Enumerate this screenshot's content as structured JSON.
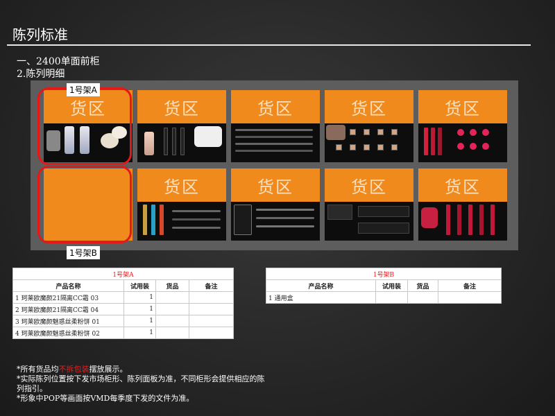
{
  "page": {
    "title": "陈列标准",
    "heading_1": "一、2400单面前柜",
    "heading_2": "2.陈列明细"
  },
  "tiles": {
    "band_label": "货区"
  },
  "racks": {
    "a_label": "1号架A",
    "b_label": "1号架B"
  },
  "table_a": {
    "caption": "1号架A",
    "headers": [
      "产品名称",
      "试用装",
      "货品",
      "备注"
    ],
    "rows": [
      {
        "name": "1 珂莱欧魔颜21隔离CC霜 03",
        "tester": "1",
        "goods": "",
        "note": ""
      },
      {
        "name": "2 珂莱欧魔颜21隔离CC霜 04",
        "tester": "1",
        "goods": "",
        "note": ""
      },
      {
        "name": "3 珂莱欧魔颜魅惑丝柔粉饼 01",
        "tester": "1",
        "goods": "",
        "note": ""
      },
      {
        "name": "4 珂莱欧魔颜魅惑丝柔粉饼 02",
        "tester": "1",
        "goods": "",
        "note": ""
      }
    ]
  },
  "table_b": {
    "caption": "1号架B",
    "headers": [
      "产品名称",
      "试用装",
      "货品",
      "备注"
    ],
    "rows": [
      {
        "name": "1 通用盒",
        "tester": "",
        "goods": "",
        "note": ""
      }
    ]
  },
  "notes": {
    "line1_prefix": "*所有货品均",
    "line1_highlight": "不拆包装",
    "line1_suffix": "摆放展示。",
    "line2": "*实际陈列位置按下发市场柜形、陈列面板为准，不同柜形会提供相应的陈列指引。",
    "line3": "*形象中POP等画面按VMD每季度下发的文件为准。"
  },
  "colors": {
    "accent_orange": "#f08a1c",
    "highlight_red": "#e02020"
  }
}
